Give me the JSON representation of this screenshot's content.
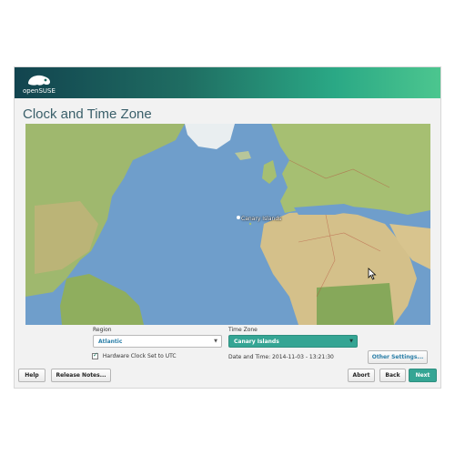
{
  "brand": {
    "logo_text": "openSUSE"
  },
  "page": {
    "title": "Clock and Time Zone"
  },
  "map": {
    "selected_marker_label": "Canary Islands"
  },
  "region": {
    "label": "Region",
    "value": "Atlantic"
  },
  "timezone": {
    "label": "Time Zone",
    "value": "Canary Islands"
  },
  "hardware_clock": {
    "label": "Hardware Clock Set to UTC",
    "checked": true
  },
  "datetime": {
    "text": "Date and Time: 2014-11-03 - 13:21:30"
  },
  "buttons": {
    "other_settings": "Other Settings...",
    "help": "Help",
    "release_notes": "Release Notes...",
    "abort": "Abort",
    "back": "Back",
    "next": "Next"
  },
  "colors": {
    "accent": "#35a594",
    "title": "#3a5f6a"
  },
  "icons": {
    "logo": "chameleon-logo",
    "dropdown": "chevron-down-icon",
    "pointer": "mouse-cursor-icon"
  }
}
